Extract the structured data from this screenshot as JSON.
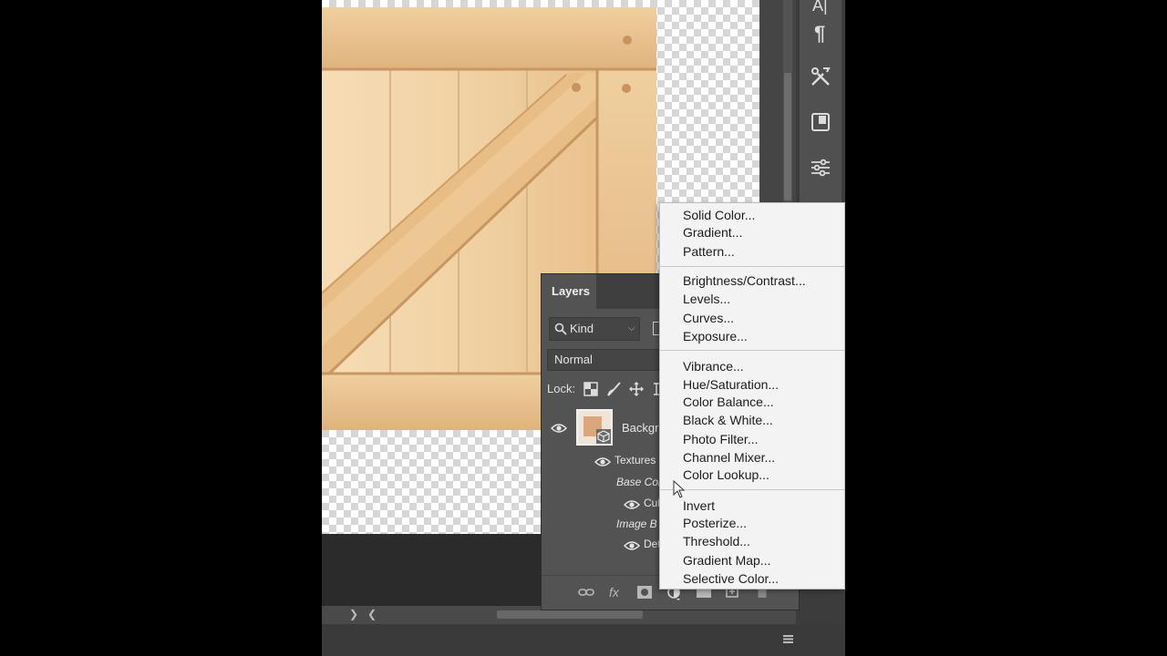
{
  "layers_panel": {
    "tab_label": "Layers",
    "filter_label": "Kind",
    "blend_mode": "Normal",
    "lock_label": "Lock:",
    "layers": [
      {
        "name": "Backgro",
        "visible": true,
        "kind": "smart-object"
      },
      {
        "name": "Textures",
        "visible": true,
        "kind": "filter-group"
      },
      {
        "name": "Base Col",
        "visible": false,
        "kind": "section-label"
      },
      {
        "name": "Cul",
        "visible": true,
        "kind": "effect"
      },
      {
        "name": "Image B",
        "visible": false,
        "kind": "section-label"
      },
      {
        "name": "Det",
        "visible": true,
        "kind": "effect"
      }
    ],
    "footer_icons": [
      "link-icon",
      "fx-icon",
      "mask-icon",
      "adjustment-icon",
      "group-icon",
      "new-layer-icon",
      "trash-icon"
    ],
    "footer_fx_label": "fx"
  },
  "adjustment_menu": {
    "groups": [
      [
        "Solid Color...",
        "Gradient...",
        "Pattern..."
      ],
      [
        "Brightness/Contrast...",
        "Levels...",
        "Curves...",
        "Exposure..."
      ],
      [
        "Vibrance...",
        "Hue/Saturation...",
        "Color Balance...",
        "Black & White...",
        "Photo Filter...",
        "Channel Mixer...",
        "Color Lookup..."
      ],
      [
        "Invert",
        "Posterize...",
        "Threshold...",
        "Gradient Map...",
        "Selective Color..."
      ]
    ]
  },
  "toolbar": {
    "icons": [
      "character-icon",
      "paragraph-icon",
      "tools-icon",
      "libraries-icon",
      "adjustments-icon"
    ],
    "character_glyph": "A|",
    "paragraph_glyph": "¶"
  },
  "status_bar": {
    "left_arrow": "❯",
    "right_arrow": "❮"
  },
  "colors": {
    "app_bg": "#3c3c3c",
    "panel_bg": "#535353",
    "menu_bg": "#f3f3f3",
    "wood_light": "#f2d2a6",
    "wood_dark": "#deb07a"
  }
}
